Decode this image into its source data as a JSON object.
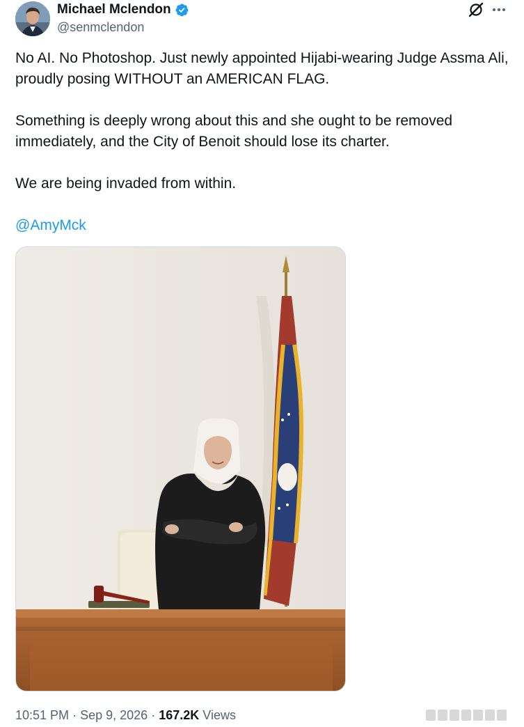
{
  "author": {
    "display_name": "Michael Mclendon",
    "handle": "@senmclendon",
    "verified": true
  },
  "icons": {
    "avatar": "avatar",
    "verified": "verified-badge-icon",
    "grok": "grok-icon",
    "more": "more-icon"
  },
  "tweet": {
    "paragraphs": [
      "No AI. No Photoshop. Just newly appointed Hijabi-wearing Judge Assma Ali, proudly posing WITHOUT an AMERICAN FLAG.",
      "Something is deeply wrong about this and she ought to be removed immediately, and the City of Benoit should lose its charter.",
      "We are being invaded from within."
    ],
    "mention": "@AmyMck"
  },
  "meta": {
    "time": "10:51 PM",
    "separator": "·",
    "date": "Sep 9, 2026",
    "views_count": "167.2K",
    "views_label": "Views"
  },
  "colors": {
    "accent": "#1d9bf0",
    "text_primary": "#0f1419",
    "text_secondary": "#536471"
  }
}
